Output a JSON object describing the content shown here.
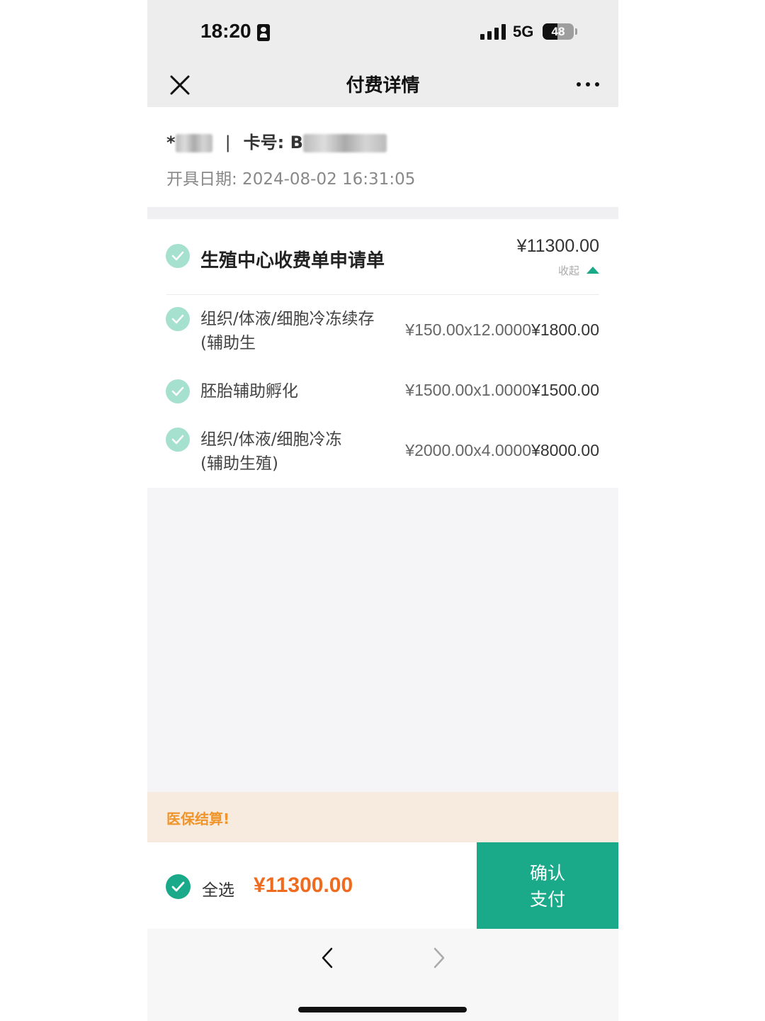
{
  "status_bar": {
    "time": "18:20",
    "network": "5G",
    "battery": "48",
    "battery_level": 0.48
  },
  "nav": {
    "title": "付费详情",
    "close_icon": "close-icon",
    "more_icon": "more-dots-icon"
  },
  "patient": {
    "name_prefix": "*",
    "card_label": "卡号: B",
    "card_tail": "",
    "issue_date": "开具日期: 2024-08-02 16:31:05"
  },
  "bill": {
    "title": "生殖中心收费单申请单",
    "total": "¥11300.00",
    "collapse_label": "收起",
    "items": [
      {
        "name": "组织/体液/细胞冷冻续存(辅助生",
        "unit_qty": "¥150.00x12.0000",
        "amount": "¥1800.00"
      },
      {
        "name": "胚胎辅助孵化",
        "unit_qty": "¥1500.00x1.0000",
        "amount": "¥1500.00"
      },
      {
        "name": "组织/体液/细胞冷冻(辅助生殖)",
        "unit_qty": "¥2000.00x4.0000",
        "amount": "¥8000.00"
      }
    ]
  },
  "insurance_banner": "医保结算!",
  "pay_bar": {
    "select_all_label": "全选",
    "total": "¥11300.00",
    "confirm_line1": "确认",
    "confirm_line2": "支付"
  },
  "colors": {
    "accent": "#1aaa8a",
    "check_light": "#a6e0cf",
    "total_orange": "#ef6b1f",
    "banner_bg": "#f7ebe0",
    "banner_text": "#f0952b"
  }
}
